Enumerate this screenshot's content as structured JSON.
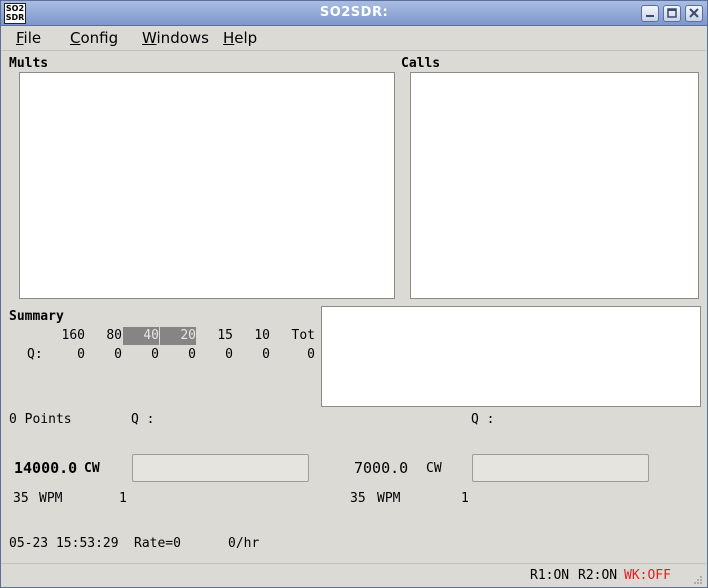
{
  "window": {
    "title": "SO2SDR:",
    "icon_text_line1": "SO2",
    "icon_text_line2": "SDR"
  },
  "menu": [
    {
      "label": "File",
      "mnemonic": "F",
      "rest": "ile"
    },
    {
      "label": "Config",
      "mnemonic": "C",
      "rest": "onfig"
    },
    {
      "label": "Windows",
      "mnemonic": "W",
      "rest": "indows"
    },
    {
      "label": "Help",
      "mnemonic": "H",
      "rest": "elp"
    }
  ],
  "panels": {
    "mults_label": "Mults",
    "calls_label": "Calls",
    "summary_label": "Summary"
  },
  "summary": {
    "bands": [
      "160",
      "80",
      "40",
      "20",
      "15",
      "10",
      "Tot"
    ],
    "highlighted_bands": [
      "40",
      "20"
    ],
    "q_label": "Q:",
    "q_values": [
      "0",
      "0",
      "0",
      "0",
      "0",
      "0",
      "0"
    ]
  },
  "points": {
    "text": "0 Points",
    "radio1_q_label": "Q :",
    "radio2_q_label": "Q :"
  },
  "radio1": {
    "freq": "14000.0",
    "mode": "CW",
    "wpm": "35",
    "wpm_label": "WPM",
    "count": "1",
    "entry_value": ""
  },
  "radio2": {
    "freq": "7000.0",
    "mode": "CW",
    "wpm": "35",
    "wpm_label": "WPM",
    "count": "1",
    "entry_value": ""
  },
  "bottom": {
    "datetime": "05-23 15:53:29",
    "rate": "Rate=0",
    "per_hour": "0/hr"
  },
  "status": {
    "r1": "R1:ON",
    "r2": "R2:ON",
    "wk": "WK:OFF",
    "wk_color": "#e02020"
  },
  "colors": {
    "titlebar": "#7d97cc",
    "band_highlight": "#858585"
  }
}
